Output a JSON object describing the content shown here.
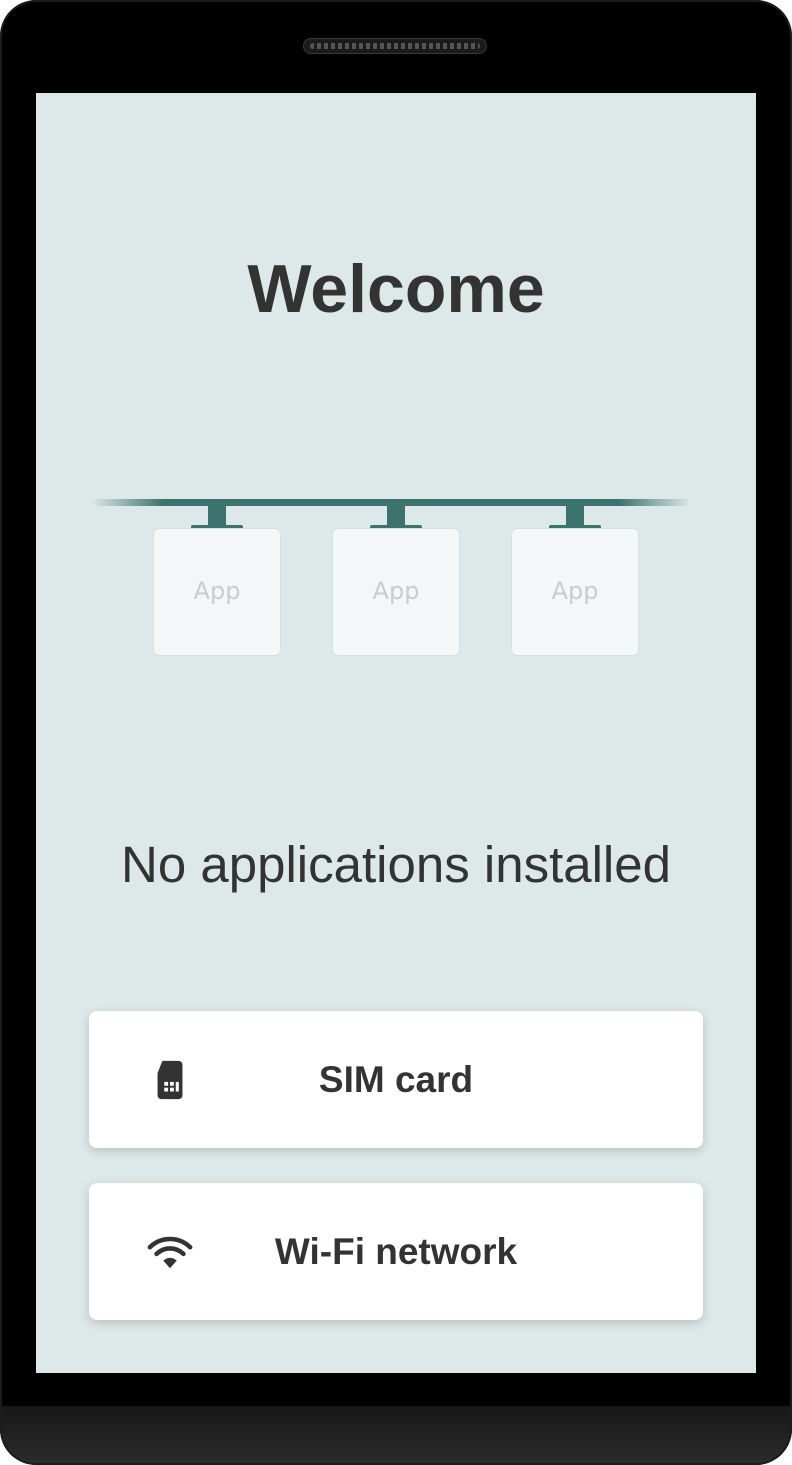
{
  "screen": {
    "title": "Welcome",
    "status_message": "No applications installed"
  },
  "illustration": {
    "cards": [
      {
        "label": "App"
      },
      {
        "label": "App"
      },
      {
        "label": "App"
      }
    ],
    "accent_color": "#3d736f"
  },
  "options": [
    {
      "label": "SIM card",
      "icon": "sim-card-icon"
    },
    {
      "label": "Wi-Fi network",
      "icon": "wifi-icon"
    }
  ],
  "colors": {
    "background": "#dde9e8",
    "text": "#333333",
    "button_bg": "#ffffff"
  }
}
